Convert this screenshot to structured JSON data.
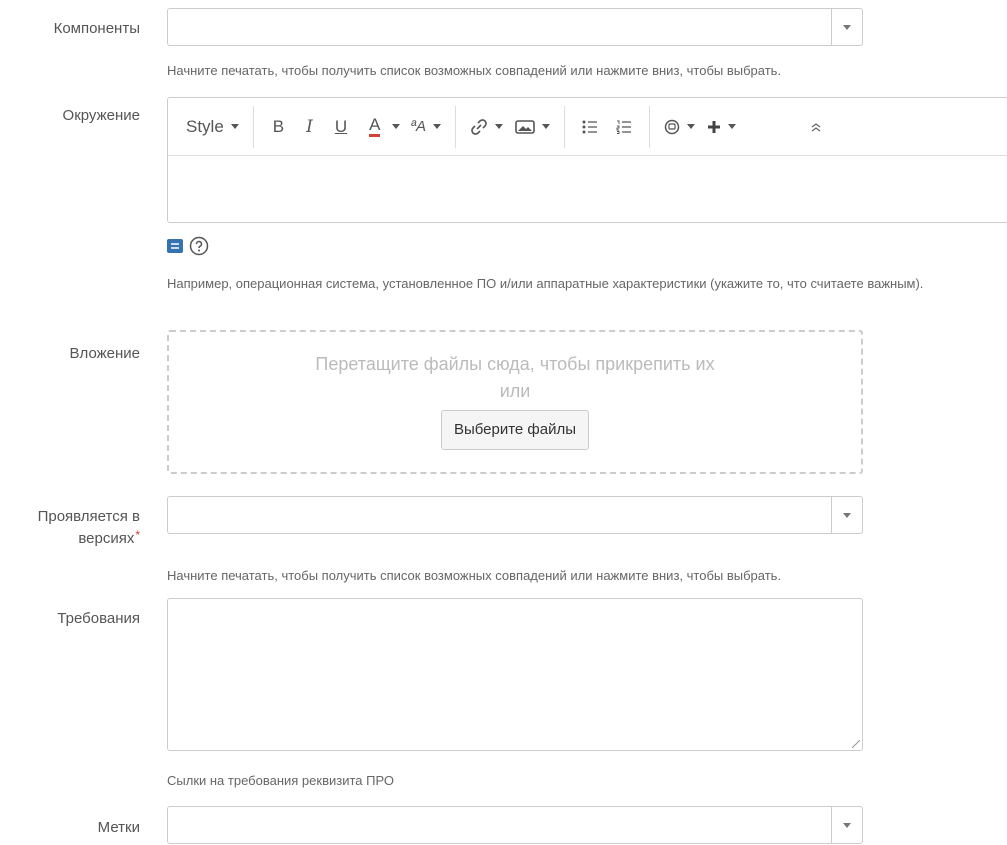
{
  "components": {
    "label": "Компоненты",
    "value": "",
    "help": "Начните печатать, чтобы получить список возможных совпадений или нажмите вниз, чтобы выбрать."
  },
  "environment": {
    "label": "Окружение",
    "toolbar": {
      "style_label": "Style",
      "bold": "B",
      "italic": "I",
      "underline": "U",
      "text_color": "A",
      "text_size": "ªA",
      "icons": [
        "link-icon",
        "image-icon",
        "bullet-list-icon",
        "numbered-list-icon",
        "emoticon-icon",
        "plus-icon",
        "collapse-icon"
      ]
    },
    "help": "Например, операционная система, установленное ПО и/или аппаратные характеристики (укажите то, что считаете важным)."
  },
  "attachment": {
    "label": "Вложение",
    "drop_text": "Перетащите файлы сюда, чтобы прикрепить их",
    "or_text": "или",
    "button_label": "Выберите файлы"
  },
  "affects_versions": {
    "label": "Проявляется в версиях",
    "required_mark": "*",
    "value": "",
    "help": "Начните печатать, чтобы получить список возможных совпадений или нажмите вниз, чтобы выбрать."
  },
  "requirements": {
    "label": "Требования",
    "value": "",
    "help": "Сылки на требования реквизита ПРО"
  },
  "labels": {
    "label": "Метки",
    "value": ""
  },
  "colors": {
    "accent_blue": "#3572b0",
    "required_red": "#d04437",
    "text_color_underline": "#d04437"
  }
}
